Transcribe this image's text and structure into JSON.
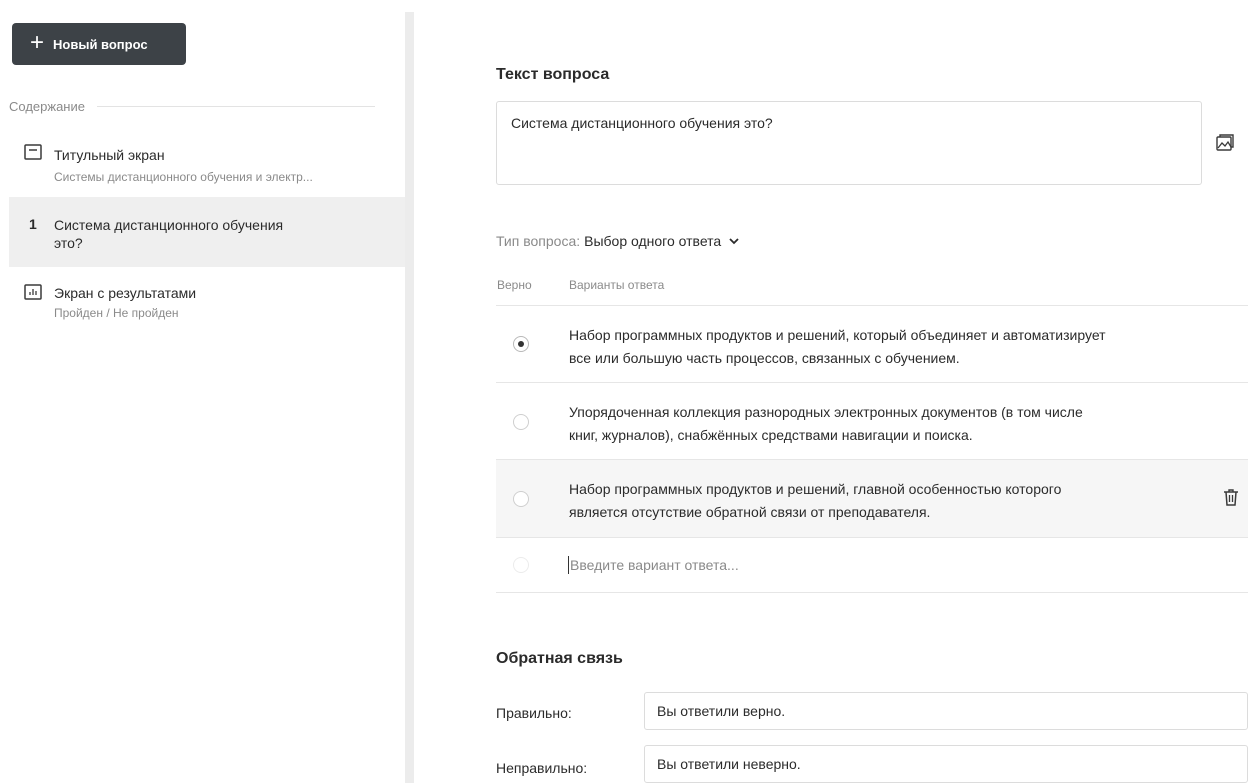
{
  "sidebar": {
    "new_question_label": "Новый вопрос",
    "section_title": "Содержание",
    "items": [
      {
        "title": "Титульный экран",
        "subtitle": "Системы дистанционного обучения и электр...",
        "icon": "title-screen-icon"
      },
      {
        "number": "1",
        "title_line1": "Система дистанционного обучения",
        "title_line2": "это?"
      },
      {
        "title": "Экран с результатами",
        "subtitle": "Пройден / Не пройден",
        "icon": "results-chart-icon"
      }
    ]
  },
  "question": {
    "section_label": "Текст вопроса",
    "text": "Система дистанционного обучения это?",
    "type_label": "Тип вопроса:",
    "type_value": "Выбор одного ответа"
  },
  "answers": {
    "col_correct": "Верно",
    "col_options": "Варианты ответа",
    "items": [
      {
        "line1": "Набор программных продуктов и решений, который объединяет и автоматизирует",
        "line2": "все или большую часть процессов, связанных с обучением.",
        "correct": true
      },
      {
        "line1": "Упорядоченная коллекция разнородных электронных документов (в том числе",
        "line2": "книг, журналов), снабжённых средствами навигации и поиска.",
        "correct": false
      },
      {
        "line1": "Набор программных продуктов и решений, главной особенностью которого",
        "line2": "является отсутствие обратной связи от преподавателя.",
        "correct": false
      }
    ],
    "new_placeholder": "Введите вариант ответа..."
  },
  "feedback": {
    "section_label": "Обратная связь",
    "correct_label": "Правильно:",
    "correct_value": "Вы ответили верно.",
    "incorrect_label": "Неправильно:",
    "incorrect_value": "Вы ответили неверно."
  }
}
